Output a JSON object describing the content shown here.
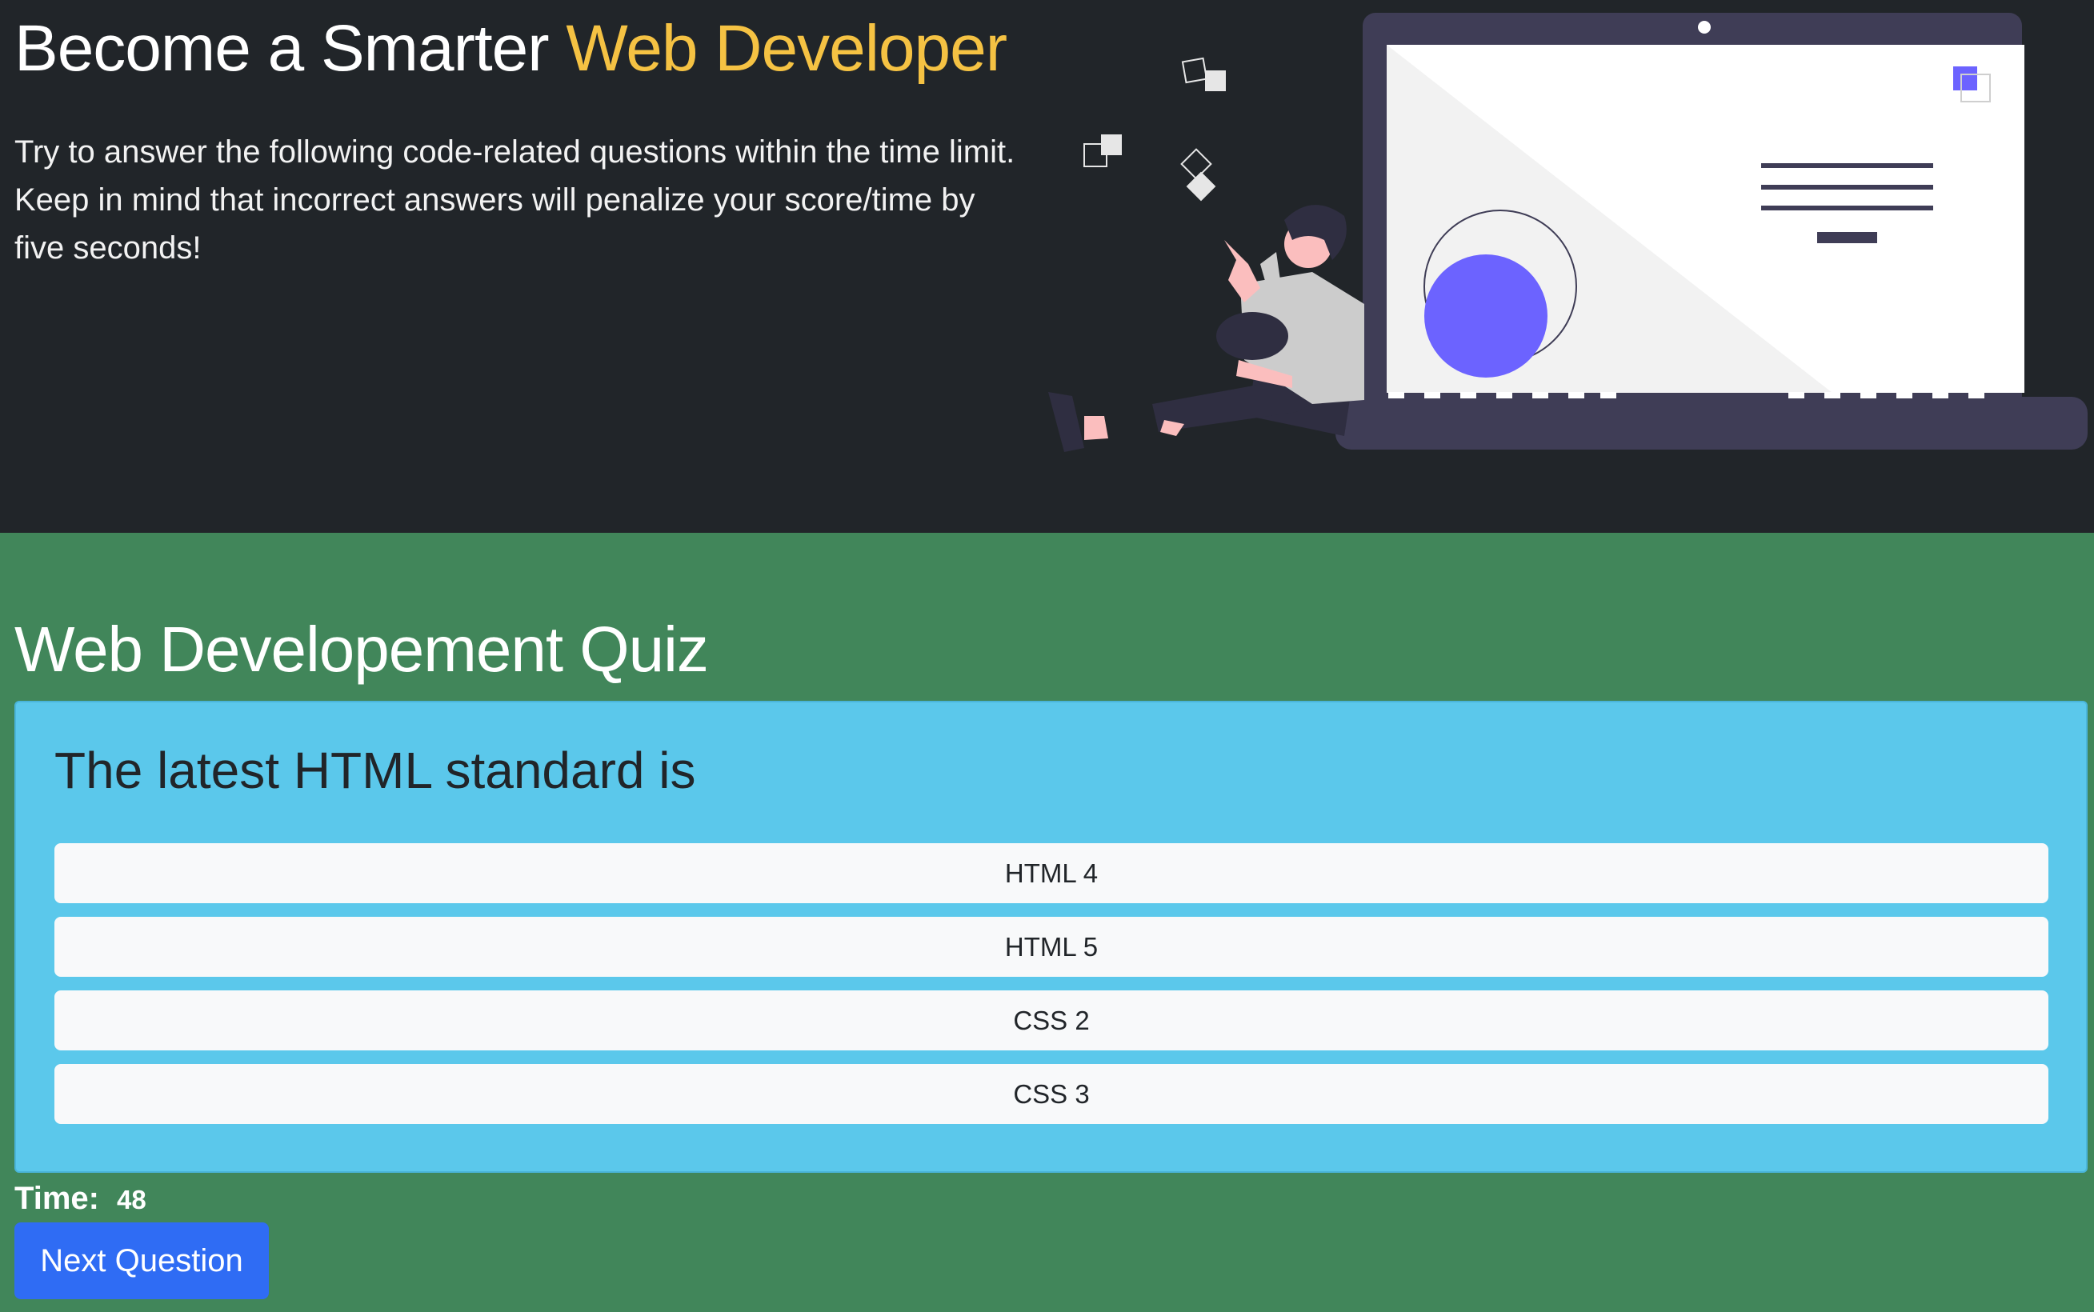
{
  "hero": {
    "title_main": "Become a Smarter ",
    "title_accent": "Web Developer",
    "description": "Try to answer the following code-related questions within the time limit. Keep in mind that incorrect answers will penalize your score/time by five seconds!",
    "illustration": "person-leaning-on-laptop-illustration"
  },
  "quiz": {
    "title": "Web Developement Quiz",
    "question": "The latest HTML standard is",
    "answers": [
      "HTML 4",
      "HTML 5",
      "CSS 2",
      "CSS 3"
    ],
    "time_label": "Time:",
    "time_value": "48",
    "next_label": "Next Question"
  },
  "colors": {
    "hero_bg": "#212529",
    "accent": "#f5c243",
    "page_bg": "#41865a",
    "card_bg": "#5bc8eb",
    "button_primary": "#2f6cf4",
    "illustration_accent": "#6c63ff"
  }
}
